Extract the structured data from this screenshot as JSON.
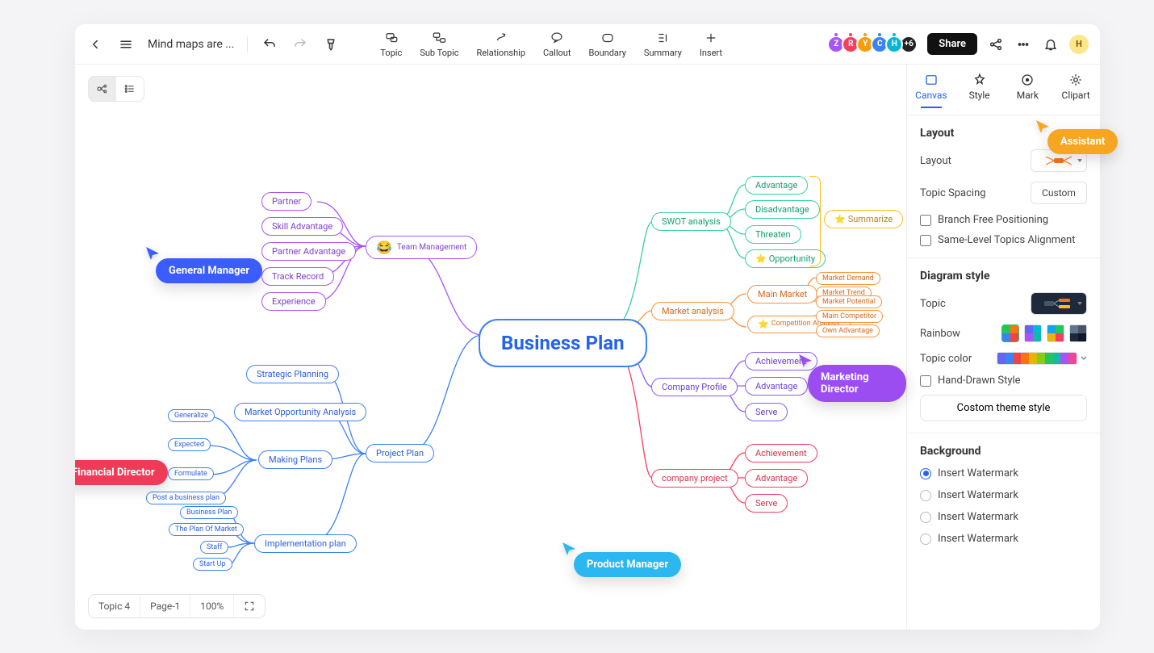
{
  "doc_title": "Mind maps are ...",
  "toolbar": {
    "topic": "Topic",
    "sub_topic": "Sub Topic",
    "relationship": "Relationship",
    "callout": "Callout",
    "boundary": "Boundary",
    "summary": "Summary",
    "insert": "Insert"
  },
  "share_label": "Share",
  "avatars": [
    "Z",
    "R",
    "Y",
    "C",
    "H"
  ],
  "avatar_extra": "+6",
  "user_letter": "H",
  "panel_tabs": {
    "canvas": "Canvas",
    "style": "Style",
    "mark": "Mark",
    "clipart": "Clipart"
  },
  "layout_sec": {
    "title": "Layout",
    "layout_label": "Layout",
    "spacing_label": "Topic Spacing",
    "spacing_value": "Custom",
    "branch_free": "Branch Free Positioning",
    "same_level": "Same-Level Topics Alignment"
  },
  "diagram_sec": {
    "title": "Diagram style",
    "topic_label": "Topic",
    "rainbow_label": "Rainbow",
    "topic_color_label": "Topic color",
    "hand_drawn": "Hand-Drawn Style",
    "custom_btn": "Costom theme style"
  },
  "background_sec": {
    "title": "Background",
    "opts": [
      "Insert Watermark",
      "Insert Watermark",
      "Insert Watermark",
      "Insert Watermark"
    ]
  },
  "status_bar": {
    "topic": "Topic 4",
    "page": "Page-1",
    "zoom": "100%"
  },
  "central": "Business Plan",
  "left_purple_parent": "Team Management",
  "left_purple_children": [
    "Partner",
    "Skill Advantage",
    "Partner Advantage",
    "Track Record",
    "Experience"
  ],
  "left_blue_parent": "Project Plan",
  "pp_c1": "Strategic Planning",
  "pp_c2": "Market Opportunity Analysis",
  "pp_c3": "Making Plans",
  "pp_c4": "Implementation plan",
  "mp_children": [
    "Generalize",
    "Expected",
    "Formulate",
    "Post a business plan"
  ],
  "ip_children": [
    "Business Plan",
    "The Plan Of Market",
    "Staff",
    "Start Up"
  ],
  "r1_parent": "SWOT analysis",
  "r1_children": [
    "Advantage",
    "Disadvantage",
    "Threaten",
    "Opportunity"
  ],
  "r1_summary": "Summarize",
  "r2_parent": "Market analysis",
  "r2_c1": "Main Market",
  "r2_c2": "Competition Analysis",
  "r2_c1_sub": [
    "Market Demand",
    "Market Trend",
    "Market Potential"
  ],
  "r2_c2_sub": [
    "Main Competitor",
    "Own Advantage"
  ],
  "r3_parent": "Company Profile",
  "r3_children": [
    "Achievement",
    "Advantage",
    "Serve"
  ],
  "r4_parent": "company project",
  "r4_children": [
    "Achievement",
    "Advantage",
    "Serve"
  ],
  "tags": {
    "general_manager": "General Manager",
    "financial_director": "Financial Director",
    "marketing_director": "Marketing Director",
    "product_manager": "Product Manager",
    "assistant": "Assistant"
  }
}
